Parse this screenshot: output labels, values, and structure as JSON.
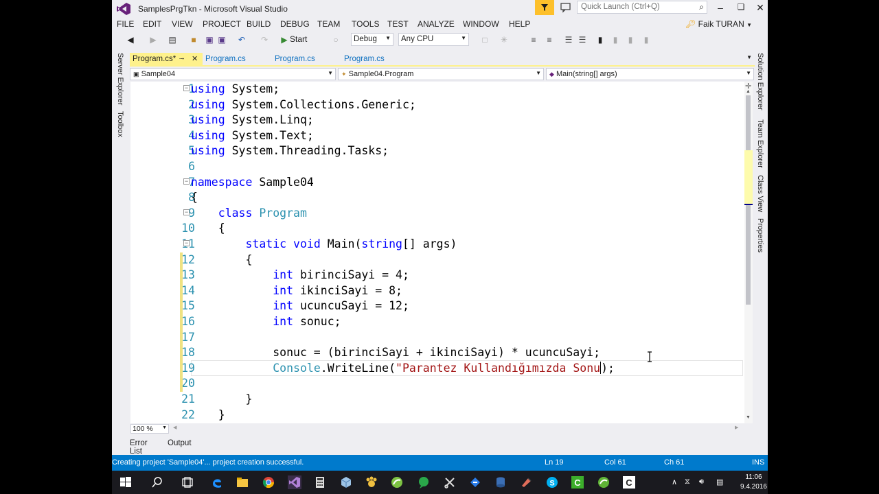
{
  "window": {
    "title": "SamplesPrgTkn - Microsoft Visual Studio",
    "quick_launch_placeholder": "Quick Launch (Ctrl+Q)",
    "user": "Faik TURAN"
  },
  "menu": [
    "FILE",
    "EDIT",
    "VIEW",
    "PROJECT",
    "BUILD",
    "DEBUG",
    "TEAM",
    "TOOLS",
    "TEST",
    "ANALYZE",
    "WINDOW",
    "HELP"
  ],
  "toolbar": {
    "start_label": "Start",
    "configuration": "Debug",
    "platform": "Any CPU"
  },
  "left_tabs": [
    "Server Explorer",
    "Toolbox"
  ],
  "right_tabs": [
    "Solution Explorer",
    "Team Explorer",
    "Class View",
    "Properties"
  ],
  "doc_tabs": [
    {
      "label": "Program.cs*",
      "active": true
    },
    {
      "label": "Program.cs",
      "active": false
    },
    {
      "label": "Program.cs",
      "active": false
    },
    {
      "label": "Program.cs",
      "active": false
    }
  ],
  "navbar": {
    "project": "Sample04",
    "type": "Sample04.Program",
    "member": "Main(string[] args)"
  },
  "code_lines": [
    {
      "n": "1"
    },
    {
      "n": "2"
    },
    {
      "n": "3"
    },
    {
      "n": "4"
    },
    {
      "n": "5"
    },
    {
      "n": "6"
    },
    {
      "n": "7"
    },
    {
      "n": "8"
    },
    {
      "n": "9"
    },
    {
      "n": "10"
    },
    {
      "n": "11"
    },
    {
      "n": "12"
    },
    {
      "n": "13"
    },
    {
      "n": "14"
    },
    {
      "n": "15"
    },
    {
      "n": "16"
    },
    {
      "n": "17"
    },
    {
      "n": "18"
    },
    {
      "n": "19"
    },
    {
      "n": "20"
    },
    {
      "n": "21"
    },
    {
      "n": "22"
    }
  ],
  "code": {
    "l1": [
      "using",
      " System;"
    ],
    "l2": [
      "using",
      " System.Collections.Generic;"
    ],
    "l3": [
      "using",
      " System.Linq;"
    ],
    "l4": [
      "using",
      " System.Text;"
    ],
    "l5": [
      "using",
      " System.Threading.Tasks;"
    ],
    "l7": [
      "namespace",
      " Sample04"
    ],
    "l8": "{",
    "l9": [
      "    ",
      "class",
      " ",
      "Program"
    ],
    "l10": "    {",
    "l11": [
      "        ",
      "static",
      " ",
      "void",
      " Main(",
      "string",
      "[] args)"
    ],
    "l12": "        {",
    "l13": [
      "            ",
      "int",
      " birinciSayi = 4;"
    ],
    "l14": [
      "            ",
      "int",
      " ikinciSayi = 8;"
    ],
    "l15": [
      "            ",
      "int",
      " ucuncuSayi = 12;"
    ],
    "l16": [
      "            ",
      "int",
      " sonuc;"
    ],
    "l18": "            sonuc = (birinciSayi + ikinciSayi) * ucuncuSayi;",
    "l19": [
      "            ",
      "Console",
      ".WriteLine(",
      "\"Parantez Kullandığımızda Sonu",
      ");"
    ],
    "l21": "        }",
    "l22": "    }"
  },
  "zoom": "100 %",
  "bottom_tabs": [
    "Error List",
    "Output"
  ],
  "status": {
    "message": "Creating project 'Sample04'... project creation successful.",
    "line": "Ln 19",
    "col": "Col 61",
    "ch": "Ch 61",
    "mode": "INS"
  },
  "clock": {
    "time": "11:06",
    "date": "9.4.2016"
  },
  "colors": {
    "accent": "#007acc",
    "keyword": "#0000ff",
    "type": "#2b91af",
    "string": "#a31515",
    "active_tab": "#fef18c"
  }
}
